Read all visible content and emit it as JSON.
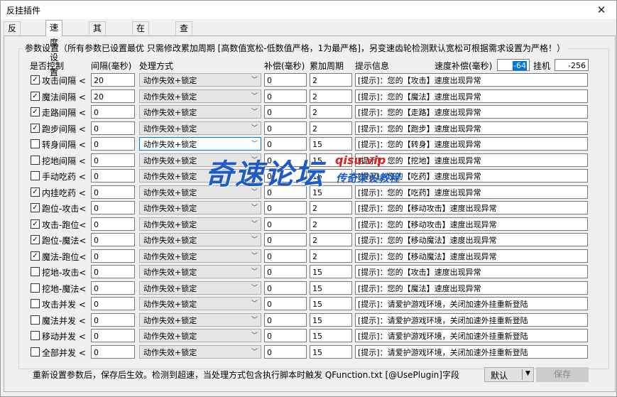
{
  "window": {
    "title": "反挂插件",
    "close_glyph": "✕"
  },
  "tabs": [
    {
      "label": "反挂设置",
      "active": false
    },
    {
      "label": "速度设置",
      "active": true
    },
    {
      "label": "其他设置",
      "active": false
    },
    {
      "label": "在线用户",
      "active": false
    },
    {
      "label": "查处记录",
      "active": false
    }
  ],
  "group_title": "参数设置（所有参数已设置最优 只需修改累加周期 [高数值宽松-低数值严格，1为最严格]，另变速齿轮检测默认宽松可根据需求设置为严格！）",
  "headers": {
    "enabled": "是否控制",
    "interval": "间隔(毫秒)",
    "action": "处理方式",
    "compensation": "补偿(毫秒)",
    "period": "累加周期",
    "message": "提示信息",
    "speed_comp_label": "速度补偿(毫秒)",
    "speed_comp_value": "-64",
    "hang_label": "挂机",
    "hang_value": "-256"
  },
  "rows": [
    {
      "label": "攻击间隔 <",
      "checked": "✓",
      "interval": "20",
      "action": "动作失效+锁定",
      "comp": "0",
      "period": "2",
      "msg": "[提示]：您的【攻击】速度出现异常"
    },
    {
      "label": "魔法间隔 <",
      "checked": "✓",
      "interval": "20",
      "action": "动作失效+锁定",
      "comp": "0",
      "period": "2",
      "msg": "[提示]：您的【魔法】速度出现异常"
    },
    {
      "label": "走路间隔 <",
      "checked": "✓",
      "interval": "0",
      "action": "动作失效+锁定",
      "comp": "0",
      "period": "2",
      "msg": "[提示]：您的【走路】速度出现异常"
    },
    {
      "label": "跑步间隔 <",
      "checked": "✓",
      "interval": "0",
      "action": "动作失效+锁定",
      "comp": "0",
      "period": "2",
      "msg": "[提示]：您的【跑步】速度出现异常"
    },
    {
      "label": "转身间隔 <",
      "checked": "",
      "interval": "0",
      "action": "动作失效+锁定",
      "comp": "0",
      "period": "15",
      "msg": "[提示]：您的【转身】速度出现异常"
    },
    {
      "label": "挖地间隔 <",
      "checked": "",
      "interval": "0",
      "action": "动作失效+锁定",
      "comp": "0",
      "period": "15",
      "msg": "[提示]：您的【挖地】速度出现异常"
    },
    {
      "label": "手动吃药 <",
      "checked": "",
      "interval": "0",
      "action": "动作失效+锁定",
      "comp": "0",
      "period": "15",
      "msg": "[提示]：您的【吃药】速度出现异常"
    },
    {
      "label": "内挂吃药 <",
      "checked": "✓",
      "interval": "0",
      "action": "动作失效+锁定",
      "comp": "0",
      "period": "15",
      "msg": "[提示]：您的【吃药】速度出现异常"
    },
    {
      "label": "跑位-攻击<",
      "checked": "✓",
      "interval": "0",
      "action": "动作失效+锁定",
      "comp": "0",
      "period": "2",
      "msg": "[提示]：您的【移动攻击】速度出现异常"
    },
    {
      "label": "攻击-跑位<",
      "checked": "✓",
      "interval": "0",
      "action": "动作失效+锁定",
      "comp": "0",
      "period": "2",
      "msg": "[提示]：您的【移动攻击】速度出现异常"
    },
    {
      "label": "跑位-魔法<",
      "checked": "✓",
      "interval": "0",
      "action": "动作失效+锁定",
      "comp": "0",
      "period": "2",
      "msg": "[提示]：您的【移动魔法】速度出现异常"
    },
    {
      "label": "魔法-跑位<",
      "checked": "✓",
      "interval": "0",
      "action": "动作失效+锁定",
      "comp": "0",
      "period": "2",
      "msg": "[提示]：您的【移动魔法】速度出现异常"
    },
    {
      "label": "挖地-攻击<",
      "checked": "",
      "interval": "0",
      "action": "动作失效+锁定",
      "comp": "0",
      "period": "15",
      "msg": "[提示]：您的【攻击】速度出现异常"
    },
    {
      "label": "挖地-魔法<",
      "checked": "",
      "interval": "0",
      "action": "动作失效+锁定",
      "comp": "0",
      "period": "15",
      "msg": "[提示]：您的【魔法】速度出现异常"
    },
    {
      "label": "攻击并发 <",
      "checked": "",
      "interval": "0",
      "action": "动作失效+锁定",
      "comp": "0",
      "period": "15",
      "msg": "[提示]：请爱护游戏环境，关闭加速外挂重新登陆"
    },
    {
      "label": "魔法并发 <",
      "checked": "",
      "interval": "0",
      "action": "动作失效+锁定",
      "comp": "0",
      "period": "15",
      "msg": "[提示]：请爱护游戏环境，关闭加速外挂重新登陆"
    },
    {
      "label": "移动并发 <",
      "checked": "",
      "interval": "0",
      "action": "动作失效+锁定",
      "comp": "0",
      "period": "15",
      "msg": "[提示]：请爱护游戏环境，关闭加速外挂重新登陆"
    },
    {
      "label": "全部并发 <",
      "checked": "",
      "interval": "0",
      "action": "动作失效+锁定",
      "comp": "0",
      "period": "15",
      "msg": "[提示]：请爱护游戏环境，关闭加速外挂重新登陆"
    }
  ],
  "footer": {
    "note": "重新设置参数后，保存后生效。检测到超速，当处理方式包含执行脚本时触发 QFunction.txt [@UsePlugin]字段",
    "default_label": "默认",
    "save_label": "保存"
  },
  "watermark": {
    "main": "奇速论坛",
    "url": "qisu.vip",
    "sub": "传奇架设教程"
  }
}
